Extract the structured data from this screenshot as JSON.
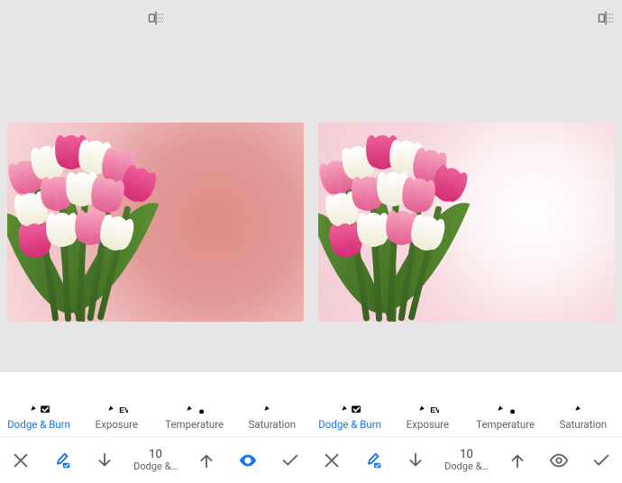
{
  "tools": [
    {
      "id": "dodge-burn",
      "label": "Dodge & Burn",
      "active": true
    },
    {
      "id": "exposure",
      "label": "Exposure",
      "active": false
    },
    {
      "id": "temperature",
      "label": "Temperature",
      "active": false
    },
    {
      "id": "saturation",
      "label": "Saturation",
      "active": false
    }
  ],
  "stepper": {
    "value": "10",
    "label": "Dodge &…"
  },
  "panes": [
    "left",
    "right"
  ]
}
